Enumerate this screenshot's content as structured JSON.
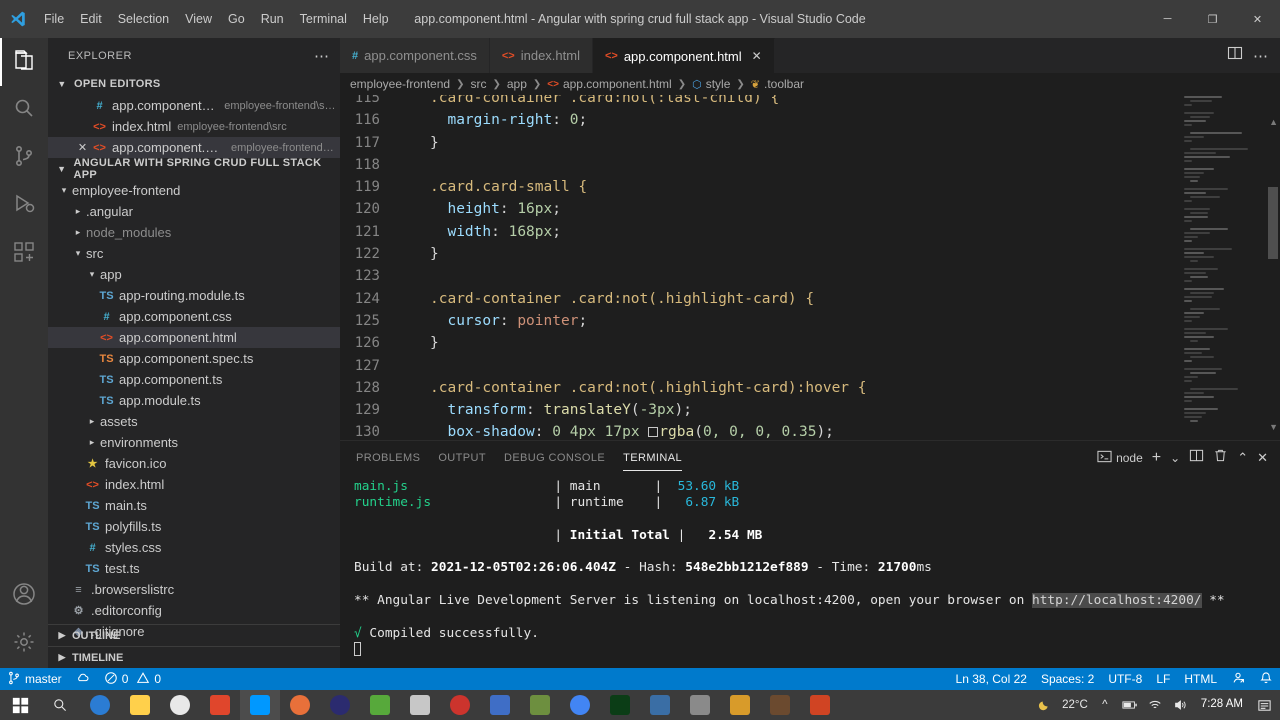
{
  "titlebar": {
    "title": "app.component.html - Angular with spring crud full stack app - Visual Studio Code",
    "menus": [
      "File",
      "Edit",
      "Selection",
      "View",
      "Go",
      "Run",
      "Terminal",
      "Help"
    ],
    "window_controls": {
      "minimize": "─",
      "maximize": "❐",
      "close": "✕"
    }
  },
  "activitybar": {
    "items": [
      {
        "name": "explorer",
        "icon": "files-icon"
      },
      {
        "name": "search",
        "icon": "search-icon"
      },
      {
        "name": "source-control",
        "icon": "source-control-icon"
      },
      {
        "name": "run-debug",
        "icon": "debug-icon"
      },
      {
        "name": "extensions",
        "icon": "extensions-icon"
      },
      {
        "name": "accounts",
        "icon": "account-icon"
      },
      {
        "name": "settings",
        "icon": "gear-icon"
      }
    ]
  },
  "sidebar": {
    "header": "EXPLORER",
    "more_actions": "⋯",
    "open_editors": {
      "label": "OPEN EDITORS",
      "items": [
        {
          "name": "app.component.css",
          "path": "employee-frontend\\src...",
          "icon": "css",
          "glyph": "#",
          "selected": false,
          "closable": false
        },
        {
          "name": "index.html",
          "path": "employee-frontend\\src",
          "icon": "html",
          "glyph": "<>",
          "selected": false,
          "closable": false
        },
        {
          "name": "app.component.html",
          "path": "employee-frontend\\s...",
          "icon": "html",
          "glyph": "<>",
          "selected": true,
          "closable": true
        }
      ]
    },
    "project": {
      "label": "ANGULAR WITH SPRING CRUD FULL STACK APP",
      "tree": [
        {
          "label": "employee-frontend",
          "depth": 0,
          "type": "folder",
          "open": true
        },
        {
          "label": ".angular",
          "depth": 1,
          "type": "folder",
          "open": false
        },
        {
          "label": "node_modules",
          "depth": 1,
          "type": "folder",
          "open": false,
          "dim": true
        },
        {
          "label": "src",
          "depth": 1,
          "type": "folder",
          "open": true
        },
        {
          "label": "app",
          "depth": 2,
          "type": "folder",
          "open": true
        },
        {
          "label": "app-routing.module.ts",
          "depth": 3,
          "type": "file",
          "icon": "ts",
          "glyph": "TS"
        },
        {
          "label": "app.component.css",
          "depth": 3,
          "type": "file",
          "icon": "css",
          "glyph": "#"
        },
        {
          "label": "app.component.html",
          "depth": 3,
          "type": "file",
          "icon": "html",
          "glyph": "<>",
          "selected": true
        },
        {
          "label": "app.component.spec.ts",
          "depth": 3,
          "type": "file",
          "icon": "ts-orange",
          "glyph": "TS"
        },
        {
          "label": "app.component.ts",
          "depth": 3,
          "type": "file",
          "icon": "ts",
          "glyph": "TS"
        },
        {
          "label": "app.module.ts",
          "depth": 3,
          "type": "file",
          "icon": "ts",
          "glyph": "TS"
        },
        {
          "label": "assets",
          "depth": 2,
          "type": "folder",
          "open": false
        },
        {
          "label": "environments",
          "depth": 2,
          "type": "folder",
          "open": false
        },
        {
          "label": "favicon.ico",
          "depth": 2,
          "type": "file",
          "icon": "star",
          "glyph": "★"
        },
        {
          "label": "index.html",
          "depth": 2,
          "type": "file",
          "icon": "html",
          "glyph": "<>"
        },
        {
          "label": "main.ts",
          "depth": 2,
          "type": "file",
          "icon": "ts",
          "glyph": "TS"
        },
        {
          "label": "polyfills.ts",
          "depth": 2,
          "type": "file",
          "icon": "ts",
          "glyph": "TS"
        },
        {
          "label": "styles.css",
          "depth": 2,
          "type": "file",
          "icon": "css",
          "glyph": "#"
        },
        {
          "label": "test.ts",
          "depth": 2,
          "type": "file",
          "icon": "ts",
          "glyph": "TS"
        },
        {
          "label": ".browserslistrc",
          "depth": 1,
          "type": "file",
          "icon": "list",
          "glyph": "≡"
        },
        {
          "label": ".editorconfig",
          "depth": 1,
          "type": "file",
          "icon": "gear",
          "glyph": "⚙"
        },
        {
          "label": ".gitignore",
          "depth": 1,
          "type": "file",
          "icon": "diamond",
          "glyph": "◈"
        }
      ]
    },
    "outline": "OUTLINE",
    "timeline": "TIMELINE"
  },
  "editor": {
    "tabs": [
      {
        "label": "app.component.css",
        "glyph": "#",
        "icon": "css",
        "active": false,
        "closable": false
      },
      {
        "label": "index.html",
        "glyph": "<>",
        "icon": "html",
        "active": false,
        "closable": false
      },
      {
        "label": "app.component.html",
        "glyph": "<>",
        "icon": "html",
        "active": true,
        "closable": true
      }
    ],
    "tab_actions": {
      "split": "split-editor-icon",
      "more": "⋯"
    },
    "breadcrumb": [
      "employee-frontend",
      "src",
      "app",
      "app.component.html",
      "style",
      ".toolbar"
    ],
    "lines": [
      {
        "num": "115",
        "tokens": [
          {
            "t": ".card-container .card:not(:last-child) {",
            "c": "t-sel"
          }
        ]
      },
      {
        "num": "116",
        "tokens": [
          {
            "t": "  ",
            "c": ""
          },
          {
            "t": "margin-right",
            "c": "t-prop"
          },
          {
            "t": ": ",
            "c": "t-punct"
          },
          {
            "t": "0",
            "c": "t-num"
          },
          {
            "t": ";",
            "c": "t-punct"
          }
        ]
      },
      {
        "num": "117",
        "tokens": [
          {
            "t": "}",
            "c": "t-punct"
          }
        ]
      },
      {
        "num": "118",
        "tokens": []
      },
      {
        "num": "119",
        "tokens": [
          {
            "t": ".card.card-small {",
            "c": "t-sel"
          }
        ]
      },
      {
        "num": "120",
        "tokens": [
          {
            "t": "  ",
            "c": ""
          },
          {
            "t": "height",
            "c": "t-prop"
          },
          {
            "t": ": ",
            "c": "t-punct"
          },
          {
            "t": "16px",
            "c": "t-num"
          },
          {
            "t": ";",
            "c": "t-punct"
          }
        ]
      },
      {
        "num": "121",
        "tokens": [
          {
            "t": "  ",
            "c": ""
          },
          {
            "t": "width",
            "c": "t-prop"
          },
          {
            "t": ": ",
            "c": "t-punct"
          },
          {
            "t": "168px",
            "c": "t-num"
          },
          {
            "t": ";",
            "c": "t-punct"
          }
        ]
      },
      {
        "num": "122",
        "tokens": [
          {
            "t": "}",
            "c": "t-punct"
          }
        ]
      },
      {
        "num": "123",
        "tokens": []
      },
      {
        "num": "124",
        "tokens": [
          {
            "t": ".card-container .card:not(.highlight-card) {",
            "c": "t-sel"
          }
        ]
      },
      {
        "num": "125",
        "tokens": [
          {
            "t": "  ",
            "c": ""
          },
          {
            "t": "cursor",
            "c": "t-prop"
          },
          {
            "t": ": ",
            "c": "t-punct"
          },
          {
            "t": "pointer",
            "c": "t-val"
          },
          {
            "t": ";",
            "c": "t-punct"
          }
        ]
      },
      {
        "num": "126",
        "tokens": [
          {
            "t": "}",
            "c": "t-punct"
          }
        ]
      },
      {
        "num": "127",
        "tokens": []
      },
      {
        "num": "128",
        "tokens": [
          {
            "t": ".card-container .card:not(.highlight-card):hover {",
            "c": "t-sel"
          }
        ]
      },
      {
        "num": "129",
        "tokens": [
          {
            "t": "  ",
            "c": ""
          },
          {
            "t": "transform",
            "c": "t-prop"
          },
          {
            "t": ": ",
            "c": "t-punct"
          },
          {
            "t": "translateY",
            "c": "t-fn"
          },
          {
            "t": "(",
            "c": "t-punct"
          },
          {
            "t": "-3px",
            "c": "t-num"
          },
          {
            "t": ");",
            "c": "t-punct"
          }
        ]
      },
      {
        "num": "130",
        "tokens": [
          {
            "t": "  ",
            "c": ""
          },
          {
            "t": "box-shadow",
            "c": "t-prop"
          },
          {
            "t": ": ",
            "c": "t-punct"
          },
          {
            "t": "0 4px 17px ",
            "c": "t-num"
          },
          {
            "t": "__COLORBOX__",
            "c": ""
          },
          {
            "t": "rgba",
            "c": "t-fn"
          },
          {
            "t": "(",
            "c": "t-punct"
          },
          {
            "t": "0, 0, 0, 0.35",
            "c": "t-num"
          },
          {
            "t": ");",
            "c": "t-punct"
          }
        ]
      }
    ]
  },
  "panel": {
    "tabs": [
      "PROBLEMS",
      "OUTPUT",
      "DEBUG CONSOLE",
      "TERMINAL"
    ],
    "active_tab": "TERMINAL",
    "shell_label": "node",
    "actions": {
      "new": "+",
      "dropdown": "⌄",
      "split": "split-terminal-icon",
      "kill": "trash-icon",
      "maximize": "⌃",
      "close": "✕"
    },
    "terminal_lines": [
      [
        {
          "t": "main.js",
          "c": "g"
        },
        {
          "t": "                   | ",
          "c": "wt"
        },
        {
          "t": "main",
          "c": "wt"
        },
        {
          "t": "       |  ",
          "c": "wt"
        },
        {
          "t": "53.60 kB",
          "c": "cy"
        }
      ],
      [
        {
          "t": "runtime.js",
          "c": "g"
        },
        {
          "t": "                | ",
          "c": "wt"
        },
        {
          "t": "runtime",
          "c": "wt"
        },
        {
          "t": "    |   ",
          "c": "wt"
        },
        {
          "t": "6.87 kB",
          "c": "cy"
        }
      ],
      [],
      [
        {
          "t": "                          | ",
          "c": "wt"
        },
        {
          "t": "Initial Total",
          "c": "bold"
        },
        {
          "t": " |   ",
          "c": "wt"
        },
        {
          "t": "2.54 MB",
          "c": "bold"
        }
      ],
      [],
      [
        {
          "t": "Build at: ",
          "c": "wt"
        },
        {
          "t": "2021-12-05T02:26:06.404Z",
          "c": "bold"
        },
        {
          "t": " - Hash: ",
          "c": "wt"
        },
        {
          "t": "548e2bb1212ef889",
          "c": "bold"
        },
        {
          "t": " - Time: ",
          "c": "wt"
        },
        {
          "t": "21700",
          "c": "bold"
        },
        {
          "t": "ms",
          "c": "wt"
        }
      ],
      [],
      [
        {
          "t": "** Angular Live Development Server is listening on localhost:4200, open your browser on ",
          "c": "wt"
        },
        {
          "t": "http://localhost:4200/",
          "c": "hl-url"
        },
        {
          "t": " **",
          "c": "wt"
        }
      ],
      [],
      [
        {
          "t": "√ ",
          "c": "g"
        },
        {
          "t": "Compiled successfully.",
          "c": "wt"
        }
      ],
      [
        {
          "t": "__CURSOR__",
          "c": ""
        }
      ]
    ]
  },
  "statusbar": {
    "left": [
      {
        "name": "remote-indicator",
        "icon": "branch-icon",
        "label": "master"
      },
      {
        "name": "sync-status",
        "icon": "cloud-icon",
        "label": ""
      },
      {
        "name": "problems",
        "icon": "error-warning-icon",
        "label": "0  0"
      }
    ],
    "branch": "master",
    "errors": "0",
    "warnings": "0",
    "cursor_position": "Ln 38, Col 22",
    "indentation": "Spaces: 2",
    "encoding": "UTF-8",
    "eol": "LF",
    "language": "HTML",
    "feedback_icon": "feedback-icon",
    "bell_icon": "bell-icon"
  },
  "taskbar": {
    "start": "start-icon",
    "search": "search-icon",
    "apps": [
      {
        "name": "edge-icon",
        "color": "#2b7cd3"
      },
      {
        "name": "file-explorer-icon",
        "color": "#ffd04b"
      },
      {
        "name": "java-icon",
        "color": "#e8e8e8"
      },
      {
        "name": "mysql-icon",
        "color": "#e0462c"
      },
      {
        "name": "vscode-icon",
        "color": "#0098ff",
        "active": true
      },
      {
        "name": "firefox-icon",
        "color": "#e8703a"
      },
      {
        "name": "navicat-icon",
        "color": "#2b2b6f"
      },
      {
        "name": "spring-icon",
        "color": "#57a93b"
      },
      {
        "name": "intellij-icon",
        "color": "#c7c7c7"
      },
      {
        "name": "ruby-icon",
        "color": "#cc342d"
      },
      {
        "name": "postman-icon",
        "color": "#3f6ec6"
      },
      {
        "name": "terminal-icon",
        "color": "#6d8f3f"
      },
      {
        "name": "chrome-icon",
        "color": "#4285f4"
      },
      {
        "name": "matrix-icon",
        "color": "#0b3d16"
      },
      {
        "name": "photos-icon",
        "color": "#3a6ea5"
      },
      {
        "name": "sql-icon",
        "color": "#8a8a8a"
      },
      {
        "name": "notes-icon",
        "color": "#d89b2a"
      },
      {
        "name": "game-icon",
        "color": "#6b4a2f"
      },
      {
        "name": "powerpoint-icon",
        "color": "#d04423"
      }
    ],
    "weather": "22°C",
    "weather_icon": "moon-icon",
    "tray": [
      "chevron-up-icon",
      "battery-icon",
      "wifi-icon",
      "volume-icon"
    ],
    "clock_time": "7:28 AM",
    "notifications_icon": "notification-icon"
  }
}
